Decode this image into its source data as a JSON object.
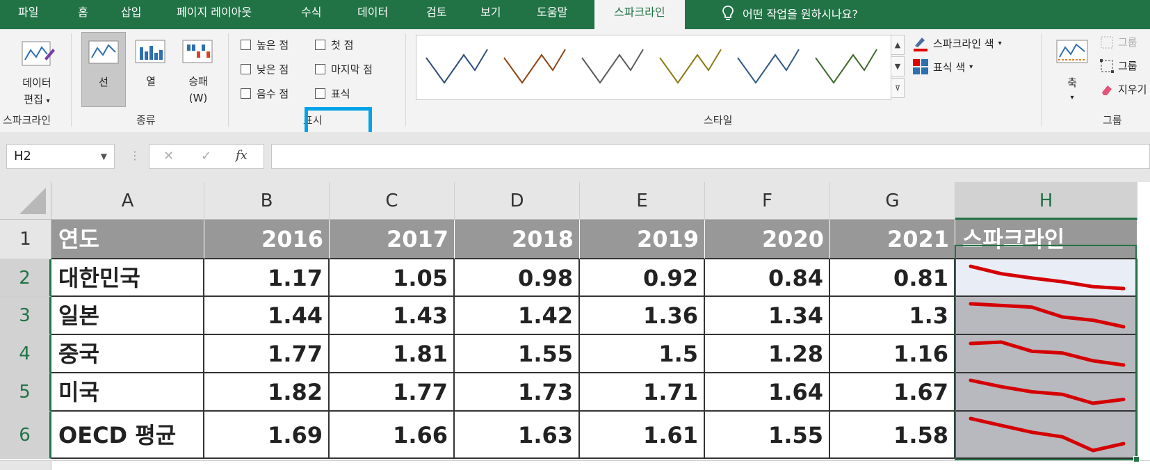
{
  "tabs": [
    {
      "label": "파일",
      "active": false
    },
    {
      "label": "홈",
      "active": false
    },
    {
      "label": "삽입",
      "active": false
    },
    {
      "label": "페이지 레이아웃",
      "active": false
    },
    {
      "label": "수식",
      "active": false
    },
    {
      "label": "데이터",
      "active": false
    },
    {
      "label": "검토",
      "active": false
    },
    {
      "label": "보기",
      "active": false
    },
    {
      "label": "도움말",
      "active": false
    },
    {
      "label": "스파크라인",
      "active": true
    }
  ],
  "tell_me": "어떤 작업을 원하시나요?",
  "ribbon": {
    "sparkline_group": {
      "edit_data_line1": "데이터",
      "edit_data_line2": "편집",
      "group_label": "스파크라인"
    },
    "type_group": {
      "line": "선",
      "column": "열",
      "winloss_line1": "승패",
      "winloss_line2": "(W)",
      "group_label": "종류"
    },
    "show_group": {
      "high_point": "높은 점",
      "first_point": "첫 점",
      "low_point": "낮은 점",
      "last_point": "마지막 점",
      "negative_points": "음수 점",
      "markers": "표식",
      "group_label": "표시"
    },
    "style_group": {
      "sparkline_color": "스파크라인 색",
      "marker_color": "표식 색",
      "group_label": "스타일",
      "swatches": [
        "#2e4d7b",
        "#8b4513",
        "#5b5b5b",
        "#8b7a14",
        "#2e5a87",
        "#3f6b2a"
      ]
    },
    "group_group": {
      "axis": "축",
      "group": "그룹",
      "ungroup": "그룹",
      "clear": "지우기",
      "group_label": "그룹"
    }
  },
  "formula_bar": {
    "name_box": "H2",
    "cancel_icon": "✕",
    "enter_icon": "✓",
    "fx_label": "fx",
    "formula": ""
  },
  "sheet": {
    "column_headers": [
      "A",
      "B",
      "C",
      "D",
      "E",
      "F",
      "G",
      "H"
    ],
    "row_headers": [
      "1",
      "2",
      "3",
      "4",
      "5",
      "6"
    ],
    "header_row": [
      "연도",
      "2016",
      "2017",
      "2018",
      "2019",
      "2020",
      "2021",
      "스파크라인"
    ],
    "rows": [
      {
        "name": "대한민국",
        "values": [
          "1.17",
          "1.05",
          "0.98",
          "0.92",
          "0.84",
          "0.81"
        ]
      },
      {
        "name": "일본",
        "values": [
          "1.44",
          "1.43",
          "1.42",
          "1.36",
          "1.34",
          "1.3"
        ]
      },
      {
        "name": "중국",
        "values": [
          "1.77",
          "1.81",
          "1.55",
          "1.5",
          "1.28",
          "1.16"
        ]
      },
      {
        "name": "미국",
        "values": [
          "1.82",
          "1.77",
          "1.73",
          "1.71",
          "1.64",
          "1.67"
        ]
      },
      {
        "name": "OECD 평균",
        "values": [
          "1.69",
          "1.66",
          "1.63",
          "1.61",
          "1.55",
          "1.58"
        ]
      }
    ],
    "selected_cell": "H2",
    "sparkline_color": "#d40000"
  }
}
